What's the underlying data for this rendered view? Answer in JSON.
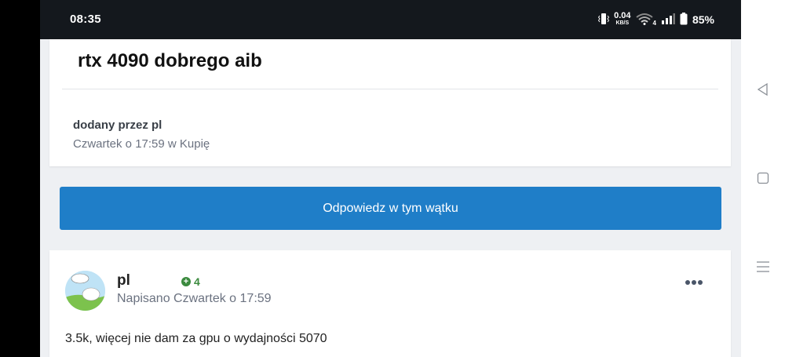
{
  "status_bar": {
    "time": "08:35",
    "net_speed_value": "0.04",
    "net_speed_unit": "KB/S",
    "network_type": "4",
    "battery": "85%"
  },
  "thread": {
    "title": "rtx 4090 dobrego aib",
    "added_by": "dodany przez pl",
    "date_line": "Czwartek o 17:59 w Kupię"
  },
  "reply_button": {
    "label": "Odpowiedz w tym wątku"
  },
  "post": {
    "author": "pl",
    "reputation": "4",
    "posted": "Napisano Czwartek o 17:59",
    "body": "3.5k, więcej nie dam za gpu o wydajności 5070"
  },
  "colors": {
    "accent": "#1f7ec8",
    "reputation": "#3b8a3e",
    "status_bar": "#14181d"
  },
  "icons": [
    "vibrate-icon",
    "wifi-icon",
    "signal-icon",
    "battery-icon",
    "more-icon",
    "back-icon",
    "home-icon",
    "recents-icon"
  ]
}
